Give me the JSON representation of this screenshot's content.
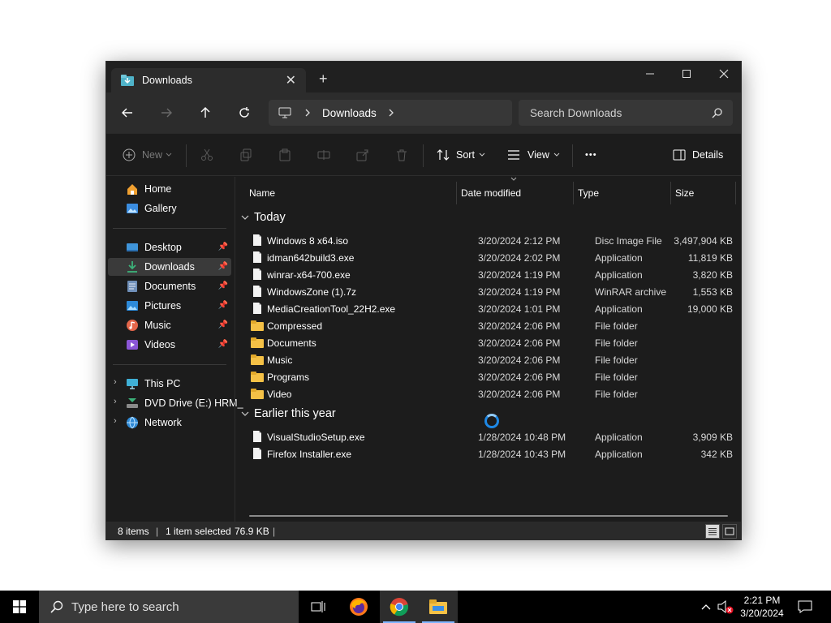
{
  "window": {
    "tab_title": "Downloads",
    "tab_close": "✕",
    "new_tab": "+",
    "controls": {
      "minimize": "—",
      "maximize": "☐",
      "close": "✕"
    }
  },
  "nav": {
    "back": "←",
    "forward": "→",
    "up": "↑",
    "refresh": "↻",
    "breadcrumb": "Downloads",
    "search_placeholder": "Search Downloads"
  },
  "commands": {
    "new": "New",
    "sort": "Sort",
    "view": "View",
    "more": "•••",
    "details": "Details"
  },
  "sidebar": {
    "items": [
      {
        "label": "Home",
        "icon": "home-icon"
      },
      {
        "label": "Gallery",
        "icon": "gallery-icon"
      },
      {
        "label": "Desktop",
        "icon": "desktop-icon",
        "pinned": true
      },
      {
        "label": "Downloads",
        "icon": "downloads-icon",
        "pinned": true,
        "selected": true
      },
      {
        "label": "Documents",
        "icon": "documents-icon",
        "pinned": true
      },
      {
        "label": "Pictures",
        "icon": "pictures-icon",
        "pinned": true
      },
      {
        "label": "Music",
        "icon": "music-icon",
        "pinned": true
      },
      {
        "label": "Videos",
        "icon": "videos-icon",
        "pinned": true
      },
      {
        "label": "This PC",
        "icon": "this-pc-icon"
      },
      {
        "label": "DVD Drive (E:) HRM_",
        "icon": "dvd-drive-icon"
      },
      {
        "label": "Network",
        "icon": "network-icon"
      }
    ]
  },
  "columns": {
    "name": "Name",
    "date_modified": "Date modified",
    "type": "Type",
    "size": "Size"
  },
  "groups": [
    {
      "label": "Today",
      "rows": [
        {
          "name": "Windows 8 x64.iso",
          "date": "3/20/2024 2:12 PM",
          "type": "Disc Image File",
          "size": "3,497,904 KB",
          "kind": "file"
        },
        {
          "name": "idman642build3.exe",
          "date": "3/20/2024 2:02 PM",
          "type": "Application",
          "size": "11,819 KB",
          "kind": "file"
        },
        {
          "name": "winrar-x64-700.exe",
          "date": "3/20/2024 1:19 PM",
          "type": "Application",
          "size": "3,820 KB",
          "kind": "file"
        },
        {
          "name": "WindowsZone (1).7z",
          "date": "3/20/2024 1:19 PM",
          "type": "WinRAR archive",
          "size": "1,553 KB",
          "kind": "file"
        },
        {
          "name": "MediaCreationTool_22H2.exe",
          "date": "3/20/2024 1:01 PM",
          "type": "Application",
          "size": "19,000 KB",
          "kind": "file"
        },
        {
          "name": "Compressed",
          "date": "3/20/2024 2:06 PM",
          "type": "File folder",
          "size": "",
          "kind": "folder"
        },
        {
          "name": "Documents",
          "date": "3/20/2024 2:06 PM",
          "type": "File folder",
          "size": "",
          "kind": "folder"
        },
        {
          "name": "Music",
          "date": "3/20/2024 2:06 PM",
          "type": "File folder",
          "size": "",
          "kind": "folder"
        },
        {
          "name": "Programs",
          "date": "3/20/2024 2:06 PM",
          "type": "File folder",
          "size": "",
          "kind": "folder"
        },
        {
          "name": "Video",
          "date": "3/20/2024 2:06 PM",
          "type": "File folder",
          "size": "",
          "kind": "folder"
        }
      ]
    },
    {
      "label": "Earlier this year",
      "rows": [
        {
          "name": "VisualStudioSetup.exe",
          "date": "1/28/2024 10:48 PM",
          "type": "Application",
          "size": "3,909 KB",
          "kind": "file"
        },
        {
          "name": "Firefox Installer.exe",
          "date": "1/28/2024 10:43 PM",
          "type": "Application",
          "size": "342 KB",
          "kind": "file"
        }
      ]
    }
  ],
  "status": {
    "items": "8 items",
    "selected": "1 item selected",
    "size": "76.9 KB"
  },
  "taskbar": {
    "search_placeholder": "Type here to search",
    "time": "2:21 PM",
    "date": "3/20/2024"
  },
  "colors": {
    "accent": "#1e88e5",
    "folder": "#f5c146",
    "window_bg": "#1c1c1c"
  }
}
